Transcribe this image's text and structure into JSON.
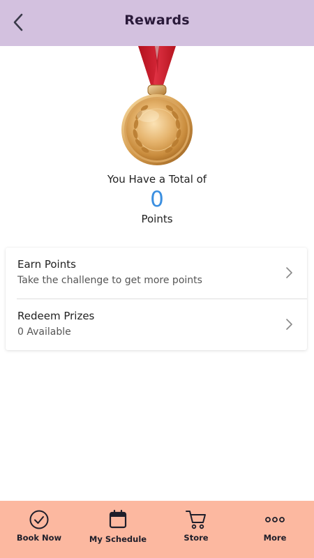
{
  "header": {
    "title": "Rewards",
    "back_icon": "chevron-left-icon",
    "background": "#d3c1df"
  },
  "summary": {
    "total_label": "You Have a Total of",
    "points_value": "0",
    "points_label": "Points",
    "points_color": "#3b8fe0",
    "medal_icon": "gold-medal-icon"
  },
  "menu": {
    "items": [
      {
        "title": "Earn Points",
        "subtitle": "Take the challenge to get more points",
        "icon": "chevron-right-icon"
      },
      {
        "title": "Redeem Prizes",
        "subtitle": "0 Available",
        "icon": "chevron-right-icon"
      }
    ]
  },
  "tabbar": {
    "background": "#fcb8a0",
    "tabs": [
      {
        "label": "Book Now",
        "icon": "check-circle-icon"
      },
      {
        "label": "My Schedule",
        "icon": "calendar-icon"
      },
      {
        "label": "Store",
        "icon": "cart-icon"
      },
      {
        "label": "More",
        "icon": "more-dots-icon"
      }
    ]
  }
}
